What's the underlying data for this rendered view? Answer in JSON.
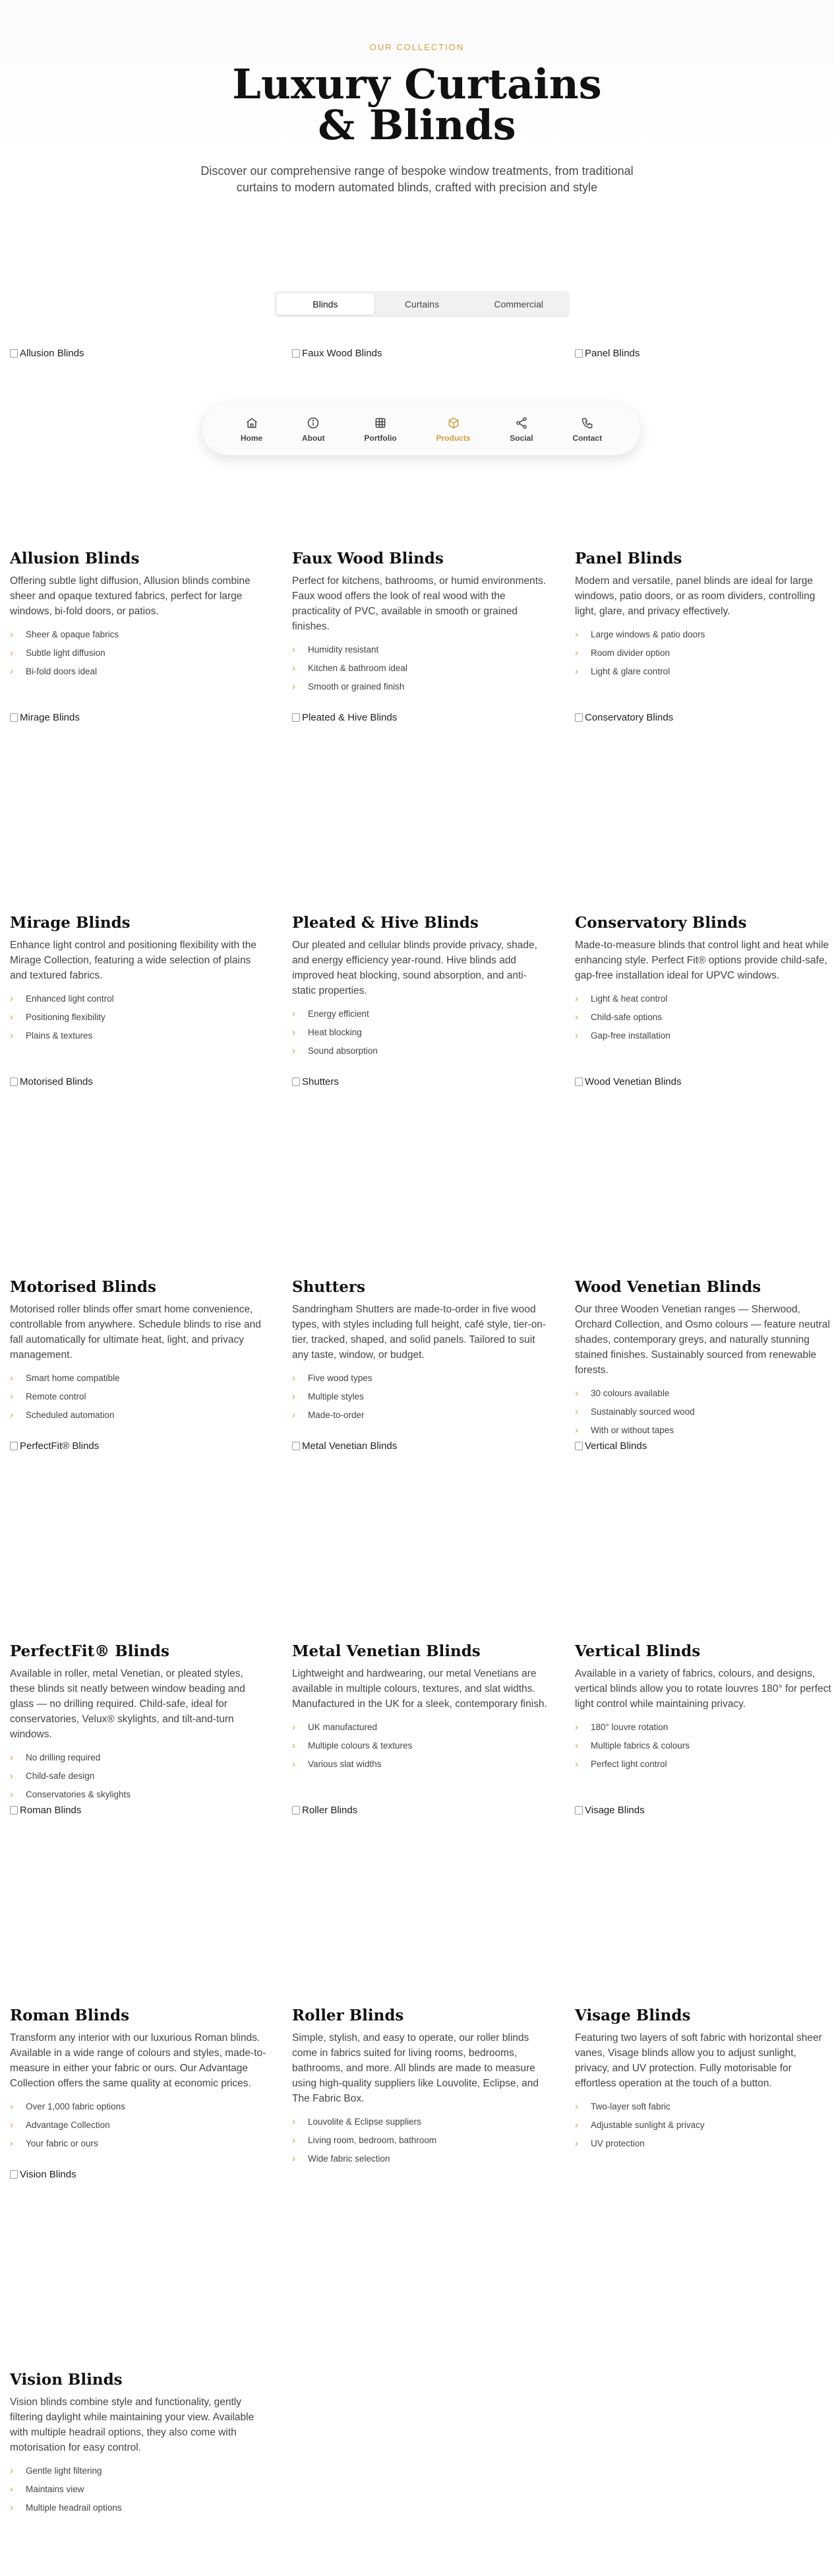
{
  "hero": {
    "eyebrow": "OUR COLLECTION",
    "title_line1": "Luxury Curtains",
    "title_line2": "& Blinds",
    "description": "Discover our comprehensive range of bespoke window treatments, from traditional curtains to modern automated blinds, crafted with precision and style"
  },
  "tabs": [
    {
      "label": "Blinds",
      "active": true
    },
    {
      "label": "Curtains",
      "active": false
    },
    {
      "label": "Commercial",
      "active": false
    }
  ],
  "nav": [
    {
      "label": "Home",
      "icon": "home-icon",
      "active": false
    },
    {
      "label": "About",
      "icon": "info-icon",
      "active": false
    },
    {
      "label": "Portfolio",
      "icon": "grid-icon",
      "active": false
    },
    {
      "label": "Products",
      "icon": "box-icon",
      "active": true
    },
    {
      "label": "Social",
      "icon": "share-icon",
      "active": false
    },
    {
      "label": "Contact",
      "icon": "phone-icon",
      "active": false
    }
  ],
  "accent_color": "#d39b3b",
  "products": [
    {
      "img_alt": "Allusion Blinds",
      "title": "Allusion Blinds",
      "description": "Offering subtle light diffusion, Allusion blinds combine sheer and opaque textured fabrics, perfect for large windows, bi-fold doors, or patios.",
      "features": [
        "Sheer & opaque fabrics",
        "Subtle light diffusion",
        "Bi-fold doors ideal"
      ]
    },
    {
      "img_alt": "Faux Wood Blinds",
      "title": "Faux Wood Blinds",
      "description": "Perfect for kitchens, bathrooms, or humid environments. Faux wood offers the look of real wood with the practicality of PVC, available in smooth or grained finishes.",
      "features": [
        "Humidity resistant",
        "Kitchen & bathroom ideal",
        "Smooth or grained finish"
      ]
    },
    {
      "img_alt": "Panel Blinds",
      "title": "Panel Blinds",
      "description": "Modern and versatile, panel blinds are ideal for large windows, patio doors, or as room dividers, controlling light, glare, and privacy effectively.",
      "features": [
        "Large windows & patio doors",
        "Room divider option",
        "Light & glare control"
      ]
    },
    {
      "img_alt": "Mirage Blinds",
      "title": "Mirage Blinds",
      "description": "Enhance light control and positioning flexibility with the Mirage Collection, featuring a wide selection of plains and textured fabrics.",
      "features": [
        "Enhanced light control",
        "Positioning flexibility",
        "Plains & textures"
      ]
    },
    {
      "img_alt": "Pleated & Hive Blinds",
      "title": "Pleated & Hive Blinds",
      "description": "Our pleated and cellular blinds provide privacy, shade, and energy efficiency year-round. Hive blinds add improved heat blocking, sound absorption, and anti-static properties.",
      "features": [
        "Energy efficient",
        "Heat blocking",
        "Sound absorption"
      ]
    },
    {
      "img_alt": "Conservatory Blinds",
      "title": "Conservatory Blinds",
      "description": "Made-to-measure blinds that control light and heat while enhancing style. Perfect Fit® options provide child-safe, gap-free installation ideal for UPVC windows.",
      "features": [
        "Light & heat control",
        "Child-safe options",
        "Gap-free installation"
      ]
    },
    {
      "img_alt": "Motorised Blinds",
      "title": "Motorised Blinds",
      "description": "Motorised roller blinds offer smart home convenience, controllable from anywhere. Schedule blinds to rise and fall automatically for ultimate heat, light, and privacy management.",
      "features": [
        "Smart home compatible",
        "Remote control",
        "Scheduled automation"
      ]
    },
    {
      "img_alt": "Shutters",
      "title": "Shutters",
      "description": "Sandringham Shutters are made-to-order in five wood types, with styles including full height, café style, tier-on-tier, tracked, shaped, and solid panels. Tailored to suit any taste, window, or budget.",
      "features": [
        "Five wood types",
        "Multiple styles",
        "Made-to-order"
      ]
    },
    {
      "img_alt": "Wood Venetian Blinds",
      "title": "Wood Venetian Blinds",
      "description": "Our three Wooden Venetian ranges — Sherwood, Orchard Collection, and Osmo colours — feature neutral shades, contemporary greys, and naturally stunning stained finishes. Sustainably sourced from renewable forests.",
      "features": [
        "30 colours available",
        "Sustainably sourced wood",
        "With or without tapes"
      ]
    },
    {
      "img_alt": "PerfectFit® Blinds",
      "title": "PerfectFit® Blinds",
      "description": "Available in roller, metal Venetian, or pleated styles, these blinds sit neatly between window beading and glass — no drilling required. Child-safe, ideal for conservatories, Velux® skylights, and tilt-and-turn windows.",
      "features": [
        "No drilling required",
        "Child-safe design",
        "Conservatories & skylights"
      ]
    },
    {
      "img_alt": "Metal Venetian Blinds",
      "title": "Metal Venetian Blinds",
      "description": "Lightweight and hardwearing, our metal Venetians are available in multiple colours, textures, and slat widths. Manufactured in the UK for a sleek, contemporary finish.",
      "features": [
        "UK manufactured",
        "Multiple colours & textures",
        "Various slat widths"
      ]
    },
    {
      "img_alt": "Vertical Blinds",
      "title": "Vertical Blinds",
      "description": "Available in a variety of fabrics, colours, and designs, vertical blinds allow you to rotate louvres 180° for perfect light control while maintaining privacy.",
      "features": [
        "180° louvre rotation",
        "Multiple fabrics & colours",
        "Perfect light control"
      ]
    },
    {
      "img_alt": "Roman Blinds",
      "title": "Roman Blinds",
      "description": "Transform any interior with our luxurious Roman blinds. Available in a wide range of colours and styles, made-to-measure in either your fabric or ours. Our Advantage Collection offers the same quality at economic prices.",
      "features": [
        "Over 1,000 fabric options",
        "Advantage Collection",
        "Your fabric or ours"
      ]
    },
    {
      "img_alt": "Roller Blinds",
      "title": "Roller Blinds",
      "description": "Simple, stylish, and easy to operate, our roller blinds come in fabrics suited for living rooms, bedrooms, bathrooms, and more. All blinds are made to measure using high-quality suppliers like Louvolite, Eclipse, and The Fabric Box.",
      "features": [
        "Louvolite & Eclipse suppliers",
        "Living room, bedroom, bathroom",
        "Wide fabric selection"
      ]
    },
    {
      "img_alt": "Visage Blinds",
      "title": "Visage Blinds",
      "description": "Featuring two layers of soft fabric with horizontal sheer vanes, Visage blinds allow you to adjust sunlight, privacy, and UV protection. Fully motorisable for effortless operation at the touch of a button.",
      "features": [
        "Two-layer soft fabric",
        "Adjustable sunlight & privacy",
        "UV protection"
      ]
    },
    {
      "img_alt": "Vision Blinds",
      "title": "Vision Blinds",
      "description": "Vision blinds combine style and functionality, gently filtering daylight while maintaining your view. Available with multiple headrail options, they also come with motorisation for easy control.",
      "features": [
        "Gentle light filtering",
        "Maintains view",
        "Multiple headrail options"
      ]
    }
  ]
}
